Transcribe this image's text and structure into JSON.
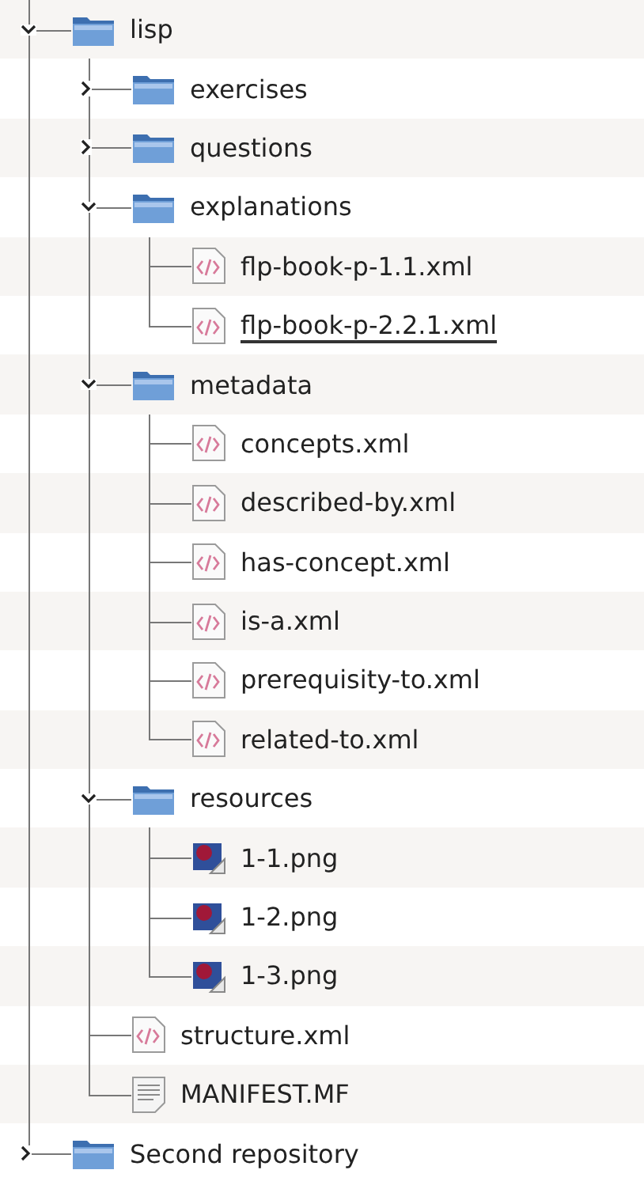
{
  "tree": [
    {
      "label": "lisp",
      "kind": "folder",
      "expanded": true,
      "children": [
        {
          "label": "exercises",
          "kind": "folder",
          "expanded": false
        },
        {
          "label": "questions",
          "kind": "folder",
          "expanded": false
        },
        {
          "label": "explanations",
          "kind": "folder",
          "expanded": true,
          "children": [
            {
              "label": "flp-book-p-1.1.xml",
              "kind": "xml"
            },
            {
              "label": "flp-book-p-2.2.1.xml",
              "kind": "xml",
              "drop_below": true
            }
          ]
        },
        {
          "label": "metadata",
          "kind": "folder",
          "expanded": true,
          "children": [
            {
              "label": "concepts.xml",
              "kind": "xml"
            },
            {
              "label": "described-by.xml",
              "kind": "xml"
            },
            {
              "label": "has-concept.xml",
              "kind": "xml"
            },
            {
              "label": "is-a.xml",
              "kind": "xml"
            },
            {
              "label": "prerequisity-to.xml",
              "kind": "xml"
            },
            {
              "label": "related-to.xml",
              "kind": "xml"
            }
          ]
        },
        {
          "label": "resources",
          "kind": "folder",
          "expanded": true,
          "children": [
            {
              "label": "1-1.png",
              "kind": "image"
            },
            {
              "label": "1-2.png",
              "kind": "image"
            },
            {
              "label": "1-3.png",
              "kind": "image"
            }
          ]
        },
        {
          "label": "structure.xml",
          "kind": "xml"
        },
        {
          "label": "MANIFEST.MF",
          "kind": "text"
        }
      ]
    },
    {
      "label": "Second repository",
      "kind": "folder",
      "expanded": false
    }
  ]
}
